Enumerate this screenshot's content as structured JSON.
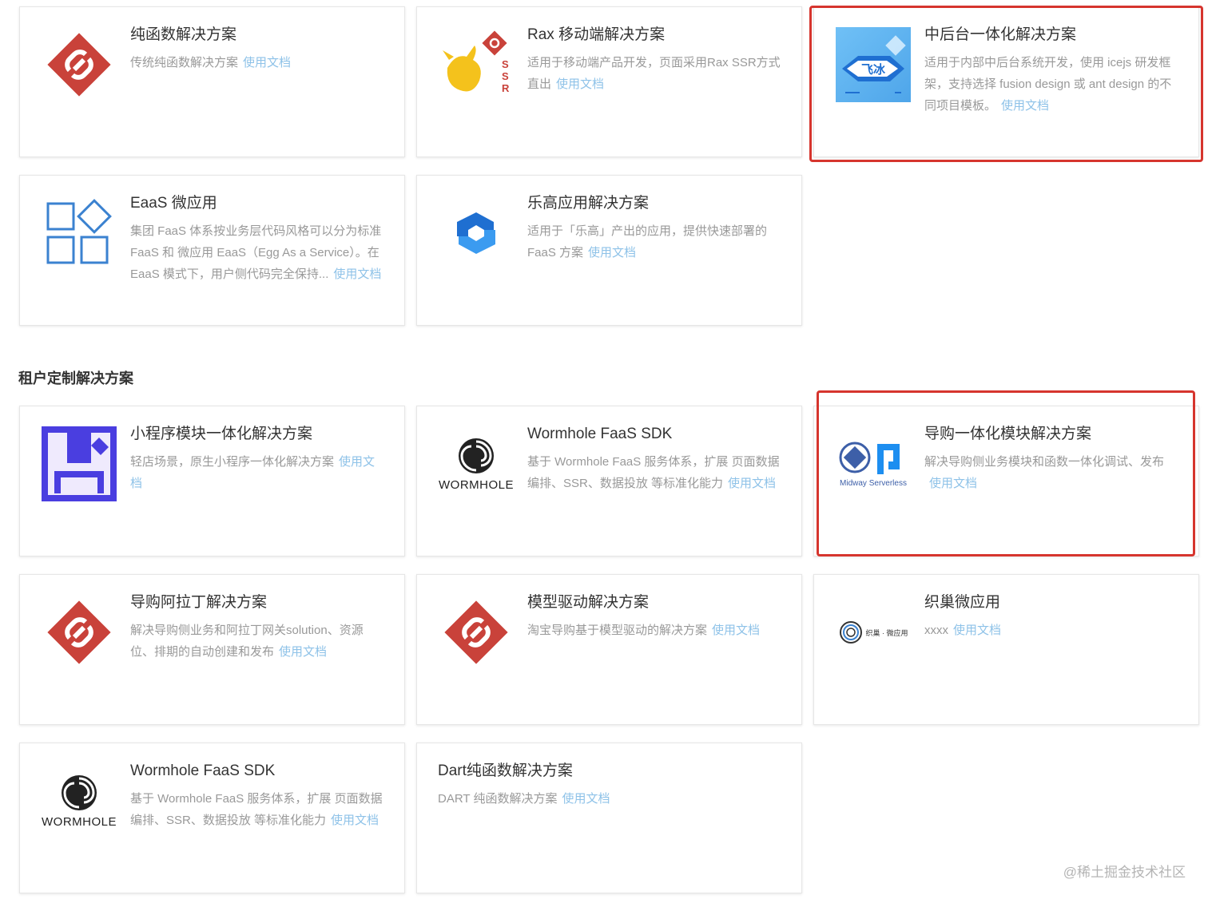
{
  "section": {
    "title": "租户定制解决方案"
  },
  "watermark": "@稀土掘金技术社区",
  "colors": {
    "link": "#8ec2e8",
    "highlight": "#d6352e",
    "title": "#333333",
    "desc": "#999999"
  },
  "cards": {
    "c1": {
      "title": "纯函数解决方案",
      "desc": "传统纯函数解决方案",
      "link": "使用文档",
      "logo": "red-diamond-icon"
    },
    "c2": {
      "title": "Rax 移动端解决方案",
      "desc": "适用于移动端产品开发，页面采用Rax SSR方式直出",
      "link": "使用文档",
      "logo": "rax-ssr-icon",
      "logo_text": "SSR"
    },
    "c3": {
      "title": "中后台一体化解决方案",
      "desc": "适用于内部中后台系统开发，使用 icejs 研发框架，支持选择 fusion design 或 ant design 的不同项目模板。",
      "link": "使用文档",
      "logo": "feibing-icon",
      "logo_text": "飞冰"
    },
    "c4": {
      "title": "EaaS 微应用",
      "desc": "集团 FaaS 体系按业务层代码风格可以分为标准 FaaS 和 微应用 EaaS（Egg As a Service）。在 EaaS 模式下，用户侧代码完全保持...",
      "link": "使用文档",
      "logo": "grid-icon"
    },
    "c5": {
      "title": "乐高应用解决方案",
      "desc": "适用于「乐高」产出的应用，提供快速部署的 FaaS 方案",
      "link": "使用文档",
      "logo": "lego-icon"
    },
    "c6": {
      "title": "小程序模块一体化解决方案",
      "desc": "轻店场景，原生小程序一体化解决方案",
      "link": "使用文档",
      "logo": "miniprogram-icon"
    },
    "c7": {
      "title": "Wormhole FaaS SDK",
      "desc": "基于 Wormhole FaaS 服务体系，扩展 页面数据编排、SSR、数据投放 等标准化能力",
      "link": "使用文档",
      "logo": "wormhole-icon",
      "logo_text": "WORMHOLE"
    },
    "c8": {
      "title": "导购一体化模块解决方案",
      "desc": "解决导购侧业务模块和函数一体化调试、发布",
      "link": "使用文档",
      "logo": "midway-icon",
      "logo_text": "Midway Serverless"
    },
    "c9": {
      "title": "导购阿拉丁解决方案",
      "desc": "解决导购侧业务和阿拉丁网关solution、资源位、排期的自动创建和发布",
      "link": "使用文档",
      "logo": "red-diamond-icon"
    },
    "c10": {
      "title": "模型驱动解决方案",
      "desc": "淘宝导购基于模型驱动的解决方案",
      "link": "使用文档",
      "logo": "red-diamond-icon"
    },
    "c11": {
      "title": "织巢微应用",
      "desc": "xxxx",
      "link": "使用文档",
      "logo": "zhichao-icon",
      "logo_text": "织巢 · 微应用"
    },
    "c12": {
      "title": "Wormhole FaaS SDK",
      "desc": "基于 Wormhole FaaS 服务体系，扩展 页面数据编排、SSR、数据投放 等标准化能力",
      "link": "使用文档",
      "logo": "wormhole-icon",
      "logo_text": "WORMHOLE"
    },
    "c13": {
      "title": "Dart纯函数解决方案",
      "desc": "DART 纯函数解决方案",
      "link": "使用文档"
    }
  }
}
